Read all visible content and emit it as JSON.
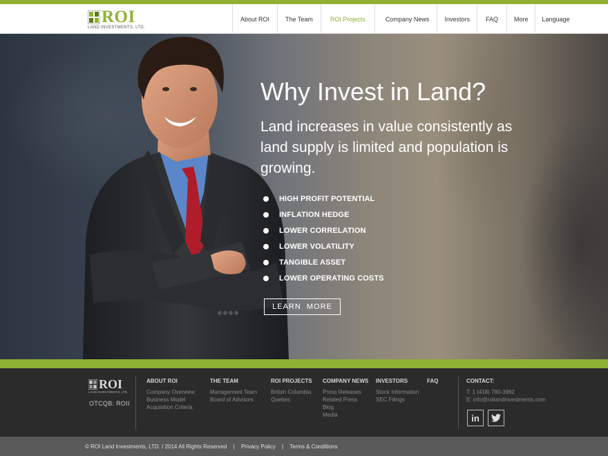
{
  "header": {
    "logo_word": "ROI",
    "logo_sub": "LAND INVESTMENTS, LTD.",
    "nav": [
      {
        "label": "About ROI"
      },
      {
        "label": "The Team"
      },
      {
        "label": "ROI Projects"
      },
      {
        "label": "Company News"
      },
      {
        "label": "Investors"
      },
      {
        "label": "FAQ"
      },
      {
        "label": "More"
      },
      {
        "label": "Language"
      }
    ],
    "active_nav": "ROI Projects"
  },
  "hero": {
    "title": "Why Invest in Land?",
    "subtitle": "Land increases in value consistently as land supply is limited and population is growing.",
    "bullets": [
      "HIGH PROFIT POTENTIAL",
      "INFLATION HEDGE",
      "LOWER CORRELATION",
      "LOWER VOLATILITY",
      "TANGIBLE ASSET",
      "LOWER OPERATING COSTS"
    ],
    "cta_label": "LEARN  MORE"
  },
  "footer": {
    "logo_word": "ROI",
    "logo_sub": "LAND INVESTMENTS, LTD.",
    "ticker": "OTCQB: ROII",
    "columns": [
      {
        "heading": "ABOUT ROI",
        "links": [
          "Company Overview",
          "Business Model",
          "Acquisition Criteria"
        ]
      },
      {
        "heading": "THE TEAM",
        "links": [
          "Management Team",
          "Board of Advisors"
        ]
      },
      {
        "heading": "ROI PROJECTS",
        "links": [
          "British Columbia",
          "Quebes"
        ]
      },
      {
        "heading": "COMPANY NEWS",
        "links": [
          "Press Releases",
          "Related Press",
          "Blog",
          "Media"
        ]
      },
      {
        "heading": "INVESTORS",
        "links": [
          "Stock Information",
          "SEC Filings"
        ]
      },
      {
        "heading": "FAQ",
        "links": []
      }
    ],
    "contact": {
      "heading": "CONTACT:",
      "phone": "T: 1 (418) 780-3982",
      "email": "E: info@roilandinvestments.com"
    },
    "social": [
      {
        "icon": "linkedin-icon",
        "label": "in"
      },
      {
        "icon": "twitter-icon"
      }
    ]
  },
  "bottom": {
    "copyright": "© ROI Land Investments, LTD. / 2014 All Rights Reserved",
    "privacy": "Privacy Policy",
    "terms": "Terms & Conditions",
    "separator": "|"
  },
  "colors": {
    "accent_green": "#8fb233",
    "footer_bg": "#2b2b2b",
    "bottom_bar": "#5a5a5a"
  }
}
